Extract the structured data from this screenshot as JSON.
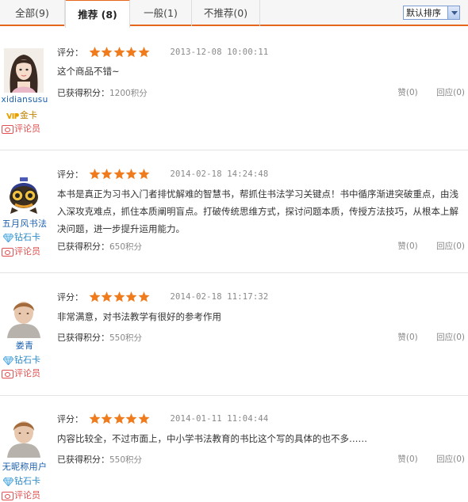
{
  "tabs": [
    {
      "label": "全部",
      "count": "(9)"
    },
    {
      "label": "推荐",
      "count": "(8)"
    },
    {
      "label": "一般",
      "count": "(1)"
    },
    {
      "label": "不推荐",
      "count": "(0)"
    }
  ],
  "sort": {
    "selected": "默认排序"
  },
  "rating_label": "评分：",
  "points_label": "已获得积分：",
  "colors": {
    "accent": "#e5661c",
    "star": "#ef7b1c",
    "link": "#1a5fad",
    "role": "#e05050"
  },
  "reviews": [
    {
      "user": "xidiansusu",
      "avatar_icon": "girl-avatar-icon",
      "card": "金卡",
      "card_icon": "vip-gold-icon",
      "role": "评论员",
      "stars": 5,
      "date": "2013-12-08 10:00:11",
      "text": "这个商品不错~",
      "points": "1200积分",
      "like": "赞(0)",
      "reply": "回应(0)"
    },
    {
      "user": "五月风书法",
      "avatar_icon": "robot-avatar-icon",
      "card": "钻石卡",
      "card_icon": "diamond-icon",
      "role": "评论员",
      "stars": 5,
      "date": "2014-02-18 14:24:48",
      "text": "本书是真正为习书入门者排忧解难的智慧书，帮抓住书法学习关键点！书中循序渐进突破重点，由浅入深攻克难点，抓住本质阐明盲点。打破传统思维方式，探讨问题本质，传授方法技巧，从根本上解决问题，进一步提升运用能力。",
      "points": "650积分",
      "like": "赞(0)",
      "reply": "回应(0)"
    },
    {
      "user": "娄青",
      "avatar_icon": "default-avatar-icon",
      "card": "钻石卡",
      "card_icon": "diamond-icon",
      "role": "评论员",
      "stars": 5,
      "date": "2014-02-18 11:17:32",
      "text": "非常满意，对书法教学有很好的参考作用",
      "points": "550积分",
      "like": "赞(0)",
      "reply": "回应(0)"
    },
    {
      "user": "无昵称用户",
      "avatar_icon": "default-avatar-icon",
      "card": "钻石卡",
      "card_icon": "diamond-icon",
      "role": "评论员",
      "stars": 5,
      "date": "2014-01-11 11:04:44",
      "text": "内容比较全，不过市面上，中小学书法教育的书比这个写的具体的也不多……",
      "points": "550积分",
      "like": "赞(0)",
      "reply": "回应(0)"
    }
  ]
}
